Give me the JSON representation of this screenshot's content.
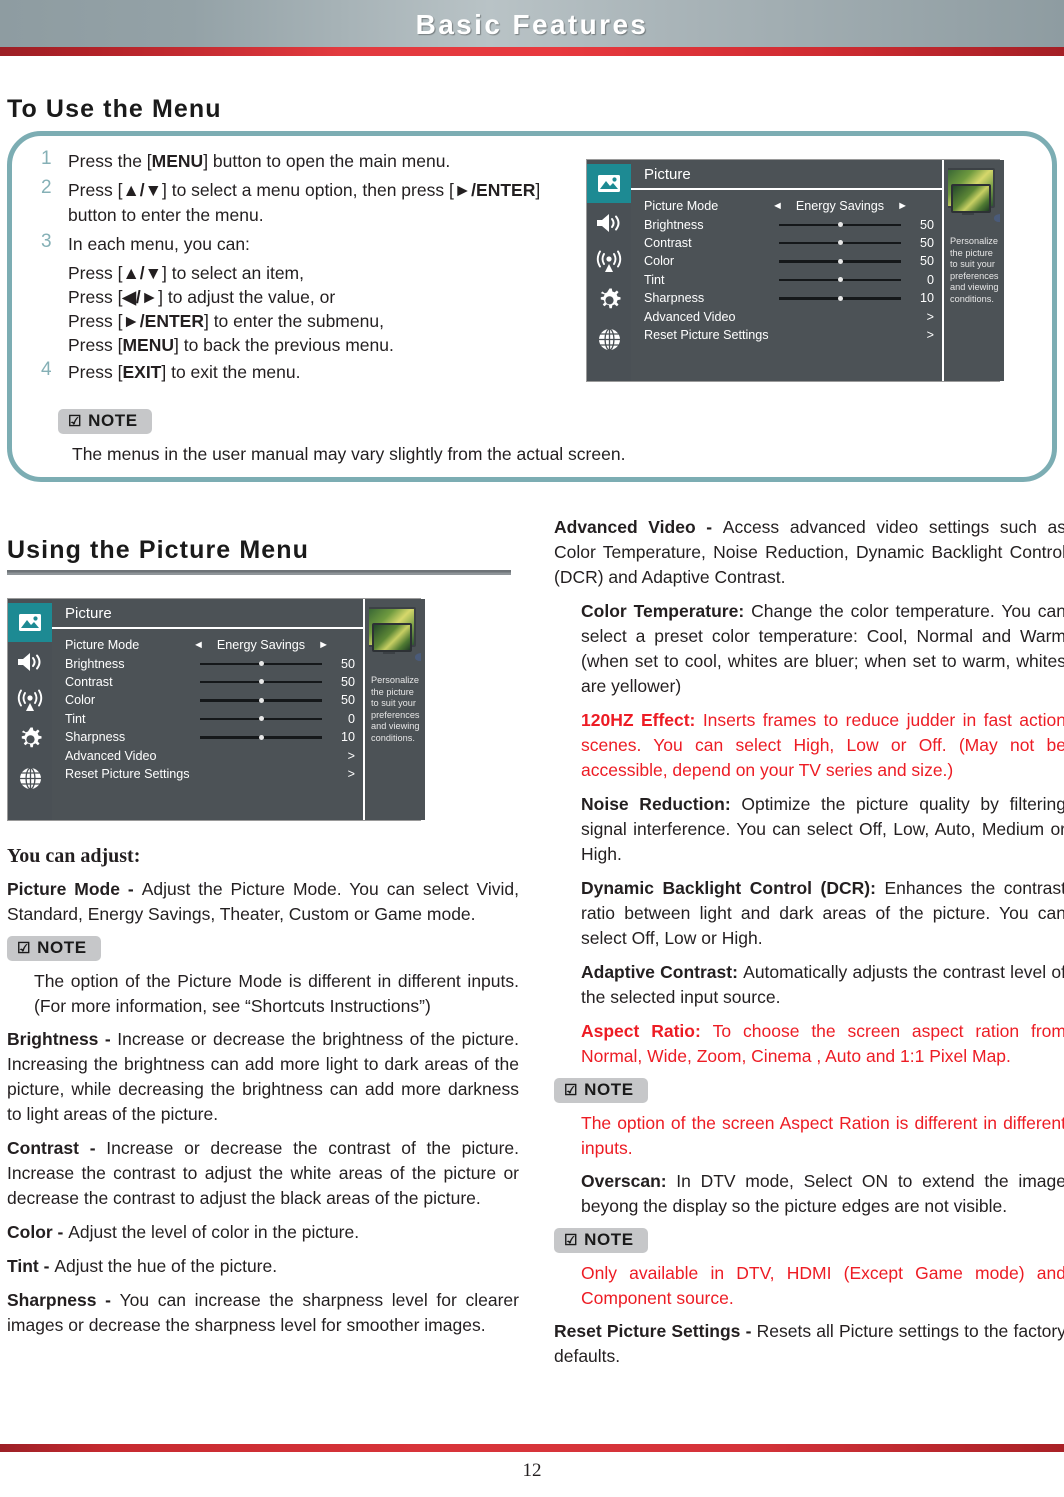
{
  "header": {
    "title": "Basic Features"
  },
  "footer": {
    "page_number": "12"
  },
  "sections": {
    "to_use_menu": {
      "heading": "To Use the Menu",
      "steps": [
        {
          "num": "1",
          "html": "Press the [<b>MENU</b>] button to open the main menu."
        },
        {
          "num": "2",
          "html": "Press [<b>&#9650;/&#9660;</b>] to select a menu option, then press [<b>&#9658;/</b><b>ENTER</b>] button to enter the menu."
        },
        {
          "num": "3",
          "html": "In each menu, you can:"
        },
        {
          "num": "4",
          "html": "Press [<b>EXIT</b>] to exit the menu."
        }
      ],
      "step3_sublines": [
        "Press [<b>&#9650;/&#9660;</b>] to select an item,",
        "Press [<b>&#9664;/&#9658;</b>] to adjust the value, or",
        "Press [<b>&#9658;/ENTER</b>] to enter the submenu,",
        "Press [<b>MENU</b>] to back the previous menu."
      ],
      "note": {
        "label": "NOTE",
        "icon": "checkbox-check-icon",
        "body": "The menus in the user manual may vary slightly from the actual screen."
      }
    },
    "using_picture_menu": {
      "heading": "Using the Picture Menu",
      "subheading": "You can adjust:"
    }
  },
  "osd": {
    "title": "Picture",
    "rail_icons": [
      "picture-icon",
      "speaker-icon",
      "antenna-icon",
      "gear-icon",
      "globe-icon"
    ],
    "rows": [
      {
        "label": "Picture Mode",
        "type": "option",
        "value": "Energy Savings",
        "left_arrow": "◄",
        "right_arrow": "►"
      },
      {
        "label": "Brightness",
        "type": "slider",
        "value": "50",
        "pct": 50
      },
      {
        "label": "Contrast",
        "type": "slider",
        "value": "50",
        "pct": 50
      },
      {
        "label": "Color",
        "type": "slider",
        "value": "50",
        "pct": 50
      },
      {
        "label": "Tint",
        "type": "slider",
        "value": "0",
        "pct": 50
      },
      {
        "label": "Sharpness",
        "type": "slider",
        "value": "10",
        "pct": 50
      },
      {
        "label": "Advanced Video",
        "type": "submenu",
        "value": ">"
      },
      {
        "label": "Reset Picture Settings",
        "type": "submenu",
        "value": ">"
      }
    ],
    "side_caption": "Personalize the picture to suit your preferences and viewing conditions.",
    "accent_color": "#1d8a93",
    "panel_color": "#4c5256"
  },
  "left_column": {
    "items": [
      {
        "term": "Picture Mode - ",
        "text": "Adjust the Picture Mode. You can select Vivid, Standard, Energy Savings, Theater, Custom or Game mode."
      },
      {
        "term": "Brightness - ",
        "text": "Increase or decrease the brightness of the picture. Increasing the brightness can add more light to dark areas of the picture, while decreasing the brightness can add more darkness to light areas of the picture."
      },
      {
        "term": "Contrast - ",
        "text": "Increase or decrease the contrast of the picture. Increase the contrast to adjust the white areas of the picture or decrease the contrast to adjust the black areas of the picture."
      },
      {
        "term": "Color - ",
        "text": "Adjust the level of color in the picture."
      },
      {
        "term": "Tint - ",
        "text": "Adjust the hue of the picture."
      },
      {
        "term": "Sharpness - ",
        "text": "You can increase the sharpness level for clearer images or decrease the sharpness level for smoother images."
      }
    ],
    "note": {
      "label": "NOTE",
      "icon": "checkbox-check-icon",
      "body": "The option of the Picture Mode is different in different inputs. (For more information, see “Shortcuts Instructions”)"
    }
  },
  "right_column": {
    "advanced_video": {
      "term": "Advanced Video - ",
      "text": "Access advanced video settings such as Color Temperature, Noise Reduction, Dynamic Backlight Control (DCR) and Adaptive Contrast."
    },
    "sub_items": [
      {
        "term": "Color Temperature: ",
        "text": "Change the color temperature. You can select a preset color temperature: Cool, Normal and Warm (when set to cool, whites are bluer; when set to warm, whites are yellower)",
        "color": "black"
      },
      {
        "term": "120HZ Effect: ",
        "text": "Inserts frames to reduce judder in fast action scenes. You can select High, Low or Off. (May not be accessible, depend on your TV series and size.)",
        "color": "red"
      },
      {
        "term": "Noise Reduction: ",
        "text": "Optimize the picture quality by filtering signal interference. You can select Off, Low, Auto, Medium or High.",
        "color": "black"
      },
      {
        "term": "Dynamic Backlight Control (DCR): ",
        "text": "Enhances the contrast ratio between light and dark areas of the picture. You can select Off, Low or High.",
        "color": "black"
      },
      {
        "term": "Adaptive Contrast: ",
        "text": "Automatically adjusts the contrast level of the selected input source.",
        "color": "black"
      },
      {
        "term": "Aspect Ratio: ",
        "text": "To choose the screen aspect ration from Normal, Wide, Zoom, Cinema , Auto and 1:1 Pixel Map.",
        "color": "red"
      }
    ],
    "note_aspect": {
      "label": "NOTE",
      "icon": "checkbox-check-icon",
      "body": "The option of the screen Aspect Ration is different in different inputs."
    },
    "overscan": {
      "term": "Overscan: ",
      "text": "In DTV mode, Select ON to extend the image beyong the display so the picture edges are not visible."
    },
    "note_overscan": {
      "label": "NOTE",
      "icon": "checkbox-check-icon",
      "body": "Only available in DTV, HDMI (Except Game mode) and Component source."
    },
    "reset": {
      "term": "Reset Picture Settings - ",
      "text": "Resets all  Picture settings to the factory defaults."
    }
  }
}
